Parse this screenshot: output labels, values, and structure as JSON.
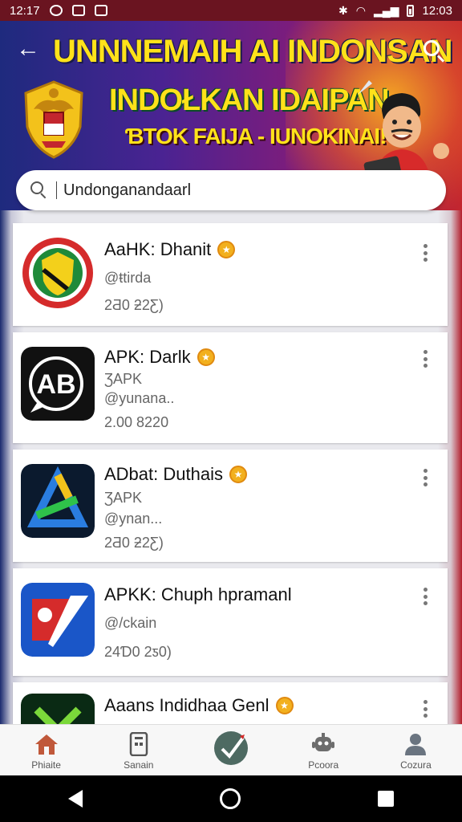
{
  "status_bar": {
    "time_left": "12:17",
    "time_right": "12:03"
  },
  "header": {
    "title": "UNNNEMAIH AI INDONSAN",
    "subtitle": "INDOŁKAN IDAIPAN",
    "tagline": "ƁTOK FAIJA - IUNOKINAI!"
  },
  "search": {
    "value": "Undonganandaarl",
    "placeholder": ""
  },
  "apps": [
    {
      "name": "AaHK: Dhanit",
      "line1": "@ŧtirda",
      "line2": "",
      "line3": "2Ƌ0 ƻ2Ƹ)",
      "verified": true,
      "icon": "shield-emblem-icon"
    },
    {
      "name": "APK: Darlk",
      "line1": "ƷAPK",
      "line2": "@yunana..",
      "line3": "2.00 8220",
      "verified": true,
      "icon": "ab-logo-icon"
    },
    {
      "name": "ADbat: Duthais",
      "line1": "ƷAPK",
      "line2": "@ynan...",
      "line3": "2Ƌ0 ƻ2Ƹ)",
      "verified": true,
      "icon": "triangle-logo-icon"
    },
    {
      "name": "APKK: Chuph hpramanl",
      "line1": "@/ckain",
      "line2": "",
      "line3": "24Ɗ0 2ƽ0)",
      "verified": false,
      "icon": "flag-shield-icon"
    },
    {
      "name": "Aaans Indidhaa Genl",
      "line1": "",
      "line2": "",
      "line3": "",
      "verified": true,
      "icon": "green-x-icon"
    }
  ],
  "bottom_nav": [
    {
      "label": "Phiaite",
      "icon": "home-icon"
    },
    {
      "label": "Sanain",
      "icon": "tablet-icon"
    },
    {
      "label": "",
      "icon": "check-circle-icon"
    },
    {
      "label": "Pcoora",
      "icon": "robot-icon"
    },
    {
      "label": "Cozura",
      "icon": "person-icon"
    }
  ],
  "colors": {
    "banner_yellow": "#ffe21a",
    "badge_gold": "#f2b01e",
    "header_blue": "#1e2a7e",
    "header_red": "#c3262e"
  }
}
